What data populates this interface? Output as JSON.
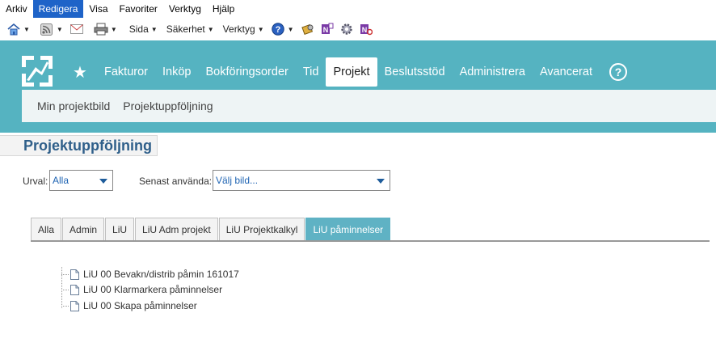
{
  "menu_bar": {
    "items": [
      "Arkiv",
      "Redigera",
      "Visa",
      "Favoriter",
      "Verktyg",
      "Hjälp"
    ],
    "active_index": 1
  },
  "command_bar": {
    "home_icon": "home-icon",
    "feeds_icon": "feeds-icon",
    "mail_icon": "mail-icon",
    "print_icon": "print-icon",
    "page_label": "Sida",
    "safety_label": "Säkerhet",
    "tools_label": "Verktyg",
    "help_icon": "help-icon",
    "extra_icons": [
      "research-icon",
      "onenote-icon",
      "settings-gear-icon",
      "onenote-linked-icon"
    ]
  },
  "app": {
    "logo_icon": "app-logo-icon",
    "favorites_icon": "star-icon",
    "nav": [
      "Fakturor",
      "Inköp",
      "Bokföringsorder",
      "Tid",
      "Projekt",
      "Beslutsstöd",
      "Administrera",
      "Avancerat"
    ],
    "nav_active_index": 4,
    "help_label": "?",
    "subnav": [
      "Min projektbild",
      "Projektuppföljning"
    ]
  },
  "page": {
    "title": "Projektuppföljning",
    "filters": {
      "urval_label": "Urval:",
      "urval_value": "Alla",
      "recent_label": "Senast använda:",
      "recent_value": "Välj bild..."
    },
    "tabs": [
      "Alla",
      "Admin",
      "LiU",
      "LiU Adm projekt",
      "LiU Projektkalkyl",
      "LiU påminnelser"
    ],
    "active_tab_index": 5,
    "tree_items": [
      "LiU 00 Bevakn/distrib påmin 161017",
      "LiU 00 Klarmarkera påminnelser",
      "LiU 00 Skapa påminnelser"
    ]
  },
  "colors": {
    "header_teal": "#55b3c1",
    "subbar": "#eef4f5",
    "active_tab": "#5fb2c4",
    "title_blue": "#2f5f8a",
    "menu_active": "#1e63c8"
  }
}
